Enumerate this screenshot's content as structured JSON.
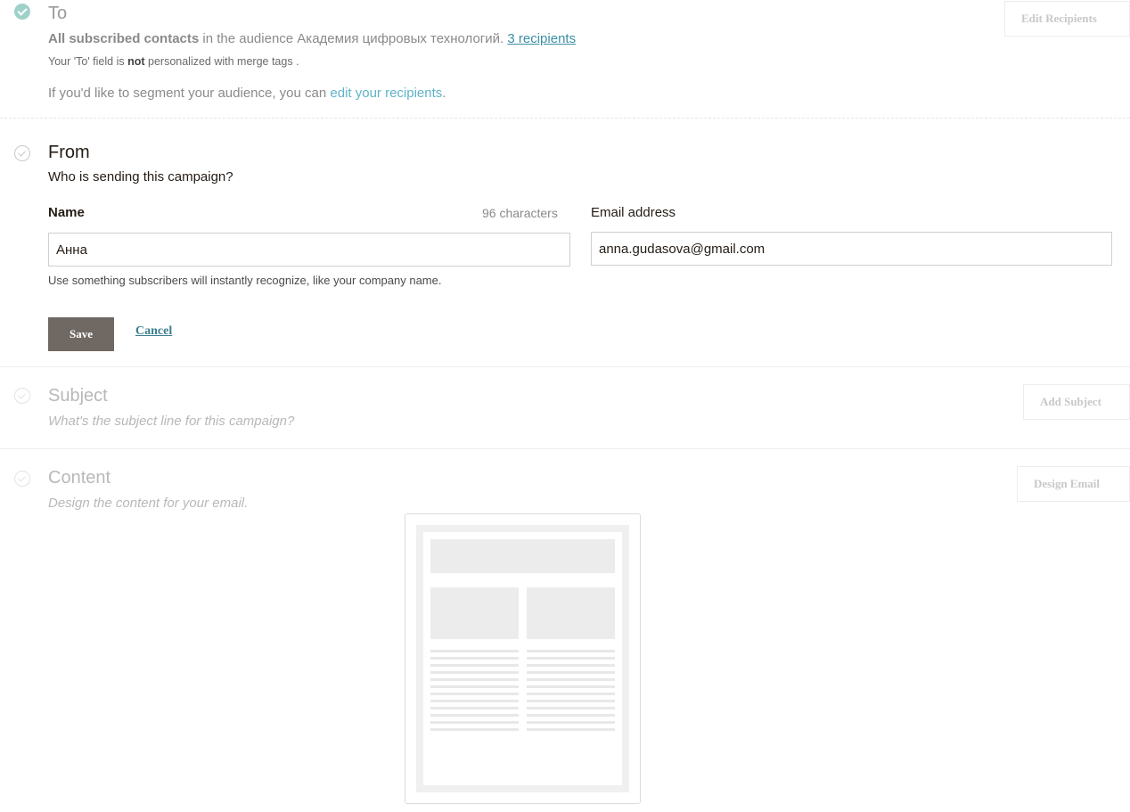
{
  "to": {
    "title": "To",
    "audience_bold": "All subscribed contacts",
    "audience_text": " in the audience Академия цифровых технологий. ",
    "recipients_link": "3 recipients",
    "merge_prefix": "Your 'To' field is ",
    "merge_bold": "not",
    "merge_suffix": " personalized with merge tags .",
    "segment_text": "If you'd like to segment your audience, you can ",
    "segment_link": "edit your recipients",
    "segment_end": ".",
    "edit_button": "Edit Recipients"
  },
  "from": {
    "title": "From",
    "subtitle": "Who is sending this campaign?",
    "name_label": "Name",
    "name_count": "96 characters",
    "name_value": "Анна",
    "email_label": "Email address",
    "email_value": "anna.gudasova@gmail.com",
    "hint": "Use something subscribers will instantly recognize, like your company name.",
    "save_label": "Save",
    "cancel_label": "Cancel"
  },
  "subject": {
    "title": "Subject",
    "subtitle": "What's the subject line for this campaign?",
    "button": "Add Subject"
  },
  "content": {
    "title": "Content",
    "subtitle": "Design the content for your email.",
    "button": "Design Email"
  },
  "colors": {
    "accent": "#5fb3c7",
    "save_button": "#706863",
    "done_check": "#5fb3a7"
  },
  "icons": {
    "to_status": "check-circle-filled",
    "from_status": "check-circle-outline",
    "subject_status": "check-circle-outline",
    "content_status": "check-circle-outline"
  }
}
